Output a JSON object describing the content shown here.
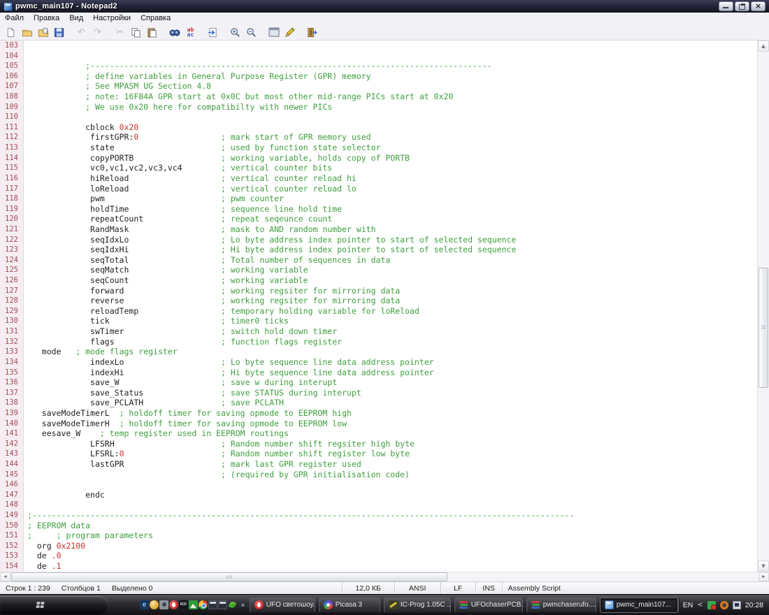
{
  "window": {
    "title": "pwmc_main107 - Notepad2"
  },
  "menu": {
    "items": [
      "Файл",
      "Правка",
      "Вид",
      "Настройки",
      "Справка"
    ]
  },
  "toolbar": {
    "icons": [
      "new-file-icon",
      "open-file-icon",
      "open-folder-view-icon",
      "save-icon",
      "undo-icon",
      "redo-icon",
      "cut-icon",
      "copy-icon",
      "paste-icon",
      "find-icon",
      "replace-icon",
      "goto-icon",
      "zoom-in-icon",
      "zoom-out-icon",
      "console-window-icon",
      "edit-scheme-icon",
      "exit-icon"
    ],
    "undo_glyph": "↶",
    "redo_glyph": "↷",
    "cut_glyph": "✂",
    "replace_top": "ab",
    "replace_bottom": "ac"
  },
  "colors": {
    "comment_green": "#3f9e3f",
    "number_red": "#cc3030",
    "line_number": "#a54e5a",
    "titlebar": "#23253a",
    "taskbar": "#2b2b31"
  },
  "editor": {
    "lines": [
      {
        "n": 103,
        "s": []
      },
      {
        "n": 104,
        "s": []
      },
      {
        "n": 105,
        "s": [
          [
            "c",
            ";-----------------------------------------------------------------------------------",
            12
          ]
        ]
      },
      {
        "n": 106,
        "s": [
          [
            "c",
            "; define variables in General Purpose Register (GPR) memory",
            12
          ]
        ]
      },
      {
        "n": 107,
        "s": [
          [
            "c",
            "; See MPASM UG Section 4.8",
            12
          ]
        ]
      },
      {
        "n": 108,
        "s": [
          [
            "c",
            "; note: 16F84A GPR start at 0x0C but most other mid-range PICs start at 0x20",
            12
          ]
        ]
      },
      {
        "n": 109,
        "s": [
          [
            "c",
            "; We use 0x20 here for compatibilty with newer PICs",
            12
          ]
        ]
      },
      {
        "n": 110,
        "s": []
      },
      {
        "n": 111,
        "s": [
          [
            "p",
            "cblock ",
            12
          ],
          [
            "n",
            "0x20"
          ]
        ]
      },
      {
        "n": 112,
        "s": [
          [
            "p",
            "firstGPR:",
            13
          ],
          [
            "n",
            "0"
          ],
          [
            "c",
            "; mark start of GPR memory used",
            40
          ]
        ]
      },
      {
        "n": 113,
        "s": [
          [
            "p",
            "state",
            13
          ],
          [
            "c",
            "; used by function state selector",
            40
          ]
        ]
      },
      {
        "n": 114,
        "s": [
          [
            "p",
            "copyPORTB",
            13
          ],
          [
            "c",
            "; working variable, holds copy of PORTB",
            40
          ]
        ]
      },
      {
        "n": 115,
        "s": [
          [
            "p",
            "vc0,vc1,vc2,vc3,vc4",
            13
          ],
          [
            "c",
            "; vertical counter bits",
            40
          ]
        ]
      },
      {
        "n": 116,
        "s": [
          [
            "p",
            "hiReload",
            13
          ],
          [
            "c",
            "; vertical counter reload hi",
            40
          ]
        ]
      },
      {
        "n": 117,
        "s": [
          [
            "p",
            "loReload",
            13
          ],
          [
            "c",
            "; vertical counter reload lo",
            40
          ]
        ]
      },
      {
        "n": 118,
        "s": [
          [
            "p",
            "pwm",
            13
          ],
          [
            "c",
            "; pwm counter",
            40
          ]
        ]
      },
      {
        "n": 119,
        "s": [
          [
            "p",
            "holdTime",
            13
          ],
          [
            "c",
            "; sequence line hold time",
            40
          ]
        ]
      },
      {
        "n": 120,
        "s": [
          [
            "p",
            "repeatCount",
            13
          ],
          [
            "c",
            "; repeat seqeunce count",
            40
          ]
        ]
      },
      {
        "n": 121,
        "s": [
          [
            "p",
            "RandMask",
            13
          ],
          [
            "c",
            "; mask to AND random number with",
            40
          ]
        ]
      },
      {
        "n": 122,
        "s": [
          [
            "p",
            "seqIdxLo",
            13
          ],
          [
            "c",
            "; Lo byte address index pointer to start of selected sequence",
            40
          ]
        ]
      },
      {
        "n": 123,
        "s": [
          [
            "p",
            "seqIdxHi",
            13
          ],
          [
            "c",
            "; Hi byte address index pointer to start of selected sequence",
            40
          ]
        ]
      },
      {
        "n": 124,
        "s": [
          [
            "p",
            "seqTotal",
            13
          ],
          [
            "c",
            "; Total number of sequences in data",
            40
          ]
        ]
      },
      {
        "n": 125,
        "s": [
          [
            "p",
            "seqMatch",
            13
          ],
          [
            "c",
            "; working variable",
            40
          ]
        ]
      },
      {
        "n": 126,
        "s": [
          [
            "p",
            "seqCount",
            13
          ],
          [
            "c",
            "; working variable",
            40
          ]
        ]
      },
      {
        "n": 127,
        "s": [
          [
            "p",
            "forward",
            13
          ],
          [
            "c",
            "; working regsiter for mirroring data",
            40
          ]
        ]
      },
      {
        "n": 128,
        "s": [
          [
            "p",
            "reverse",
            13
          ],
          [
            "c",
            "; working regsiter for mirroring data",
            40
          ]
        ]
      },
      {
        "n": 129,
        "s": [
          [
            "p",
            "reloadTemp",
            13
          ],
          [
            "c",
            "; temporary holding variable for loReload",
            40
          ]
        ]
      },
      {
        "n": 130,
        "s": [
          [
            "p",
            "tick",
            13
          ],
          [
            "c",
            "; timer0 ticks",
            40
          ]
        ]
      },
      {
        "n": 131,
        "s": [
          [
            "p",
            "swTimer",
            13
          ],
          [
            "c",
            "; switch hold down timer",
            40
          ]
        ]
      },
      {
        "n": 132,
        "s": [
          [
            "p",
            "flags",
            13
          ],
          [
            "c",
            "; function flags register",
            40
          ]
        ]
      },
      {
        "n": 133,
        "s": [
          [
            "p",
            "mode",
            3
          ],
          [
            "c",
            "; mode flags register",
            10
          ]
        ]
      },
      {
        "n": 134,
        "s": [
          [
            "p",
            "indexLo",
            13
          ],
          [
            "c",
            "; Lo byte sequence line data address pointer",
            40
          ]
        ]
      },
      {
        "n": 135,
        "s": [
          [
            "p",
            "indexHi",
            13
          ],
          [
            "c",
            "; Hi byte sequence line data address pointer",
            40
          ]
        ]
      },
      {
        "n": 136,
        "s": [
          [
            "p",
            "save_W",
            13
          ],
          [
            "c",
            "; save w during interupt",
            40
          ]
        ]
      },
      {
        "n": 137,
        "s": [
          [
            "p",
            "save_Status",
            13
          ],
          [
            "c",
            "; save STATUS during interupt",
            40
          ]
        ]
      },
      {
        "n": 138,
        "s": [
          [
            "p",
            "save_PCLATH",
            13
          ],
          [
            "c",
            "; save PCLATH",
            40
          ]
        ]
      },
      {
        "n": 139,
        "s": [
          [
            "p",
            "saveModeTimerL",
            3
          ],
          [
            "c",
            "; holdoff timer for saving opmode to EEPROM high",
            19
          ]
        ]
      },
      {
        "n": 140,
        "s": [
          [
            "p",
            "saveModeTimerH",
            3
          ],
          [
            "c",
            "; holdoff timer for saving opmode to EEPROM low",
            19
          ]
        ]
      },
      {
        "n": 141,
        "s": [
          [
            "p",
            "eesave_W",
            3
          ],
          [
            "c",
            "; temp register used in EEPROM routings",
            15
          ]
        ]
      },
      {
        "n": 142,
        "s": [
          [
            "p",
            "LFSRH",
            13
          ],
          [
            "c",
            "; Random number shift regsiter high byte",
            40
          ]
        ]
      },
      {
        "n": 143,
        "s": [
          [
            "p",
            "LFSRL:",
            13
          ],
          [
            "n",
            "0"
          ],
          [
            "c",
            "; Random number shift register low byte",
            40
          ]
        ]
      },
      {
        "n": 144,
        "s": [
          [
            "p",
            "lastGPR",
            13
          ],
          [
            "c",
            "; mark last GPR register used",
            40
          ]
        ]
      },
      {
        "n": 145,
        "s": [
          [
            "c",
            "; (required by GPR initialisation code)",
            40
          ]
        ]
      },
      {
        "n": 146,
        "s": []
      },
      {
        "n": 147,
        "s": [
          [
            "p",
            "endc",
            12
          ]
        ]
      },
      {
        "n": 148,
        "s": []
      },
      {
        "n": 149,
        "s": [
          [
            "c",
            ";----------------------------------------------------------------------------------------------------------------",
            0
          ]
        ]
      },
      {
        "n": 150,
        "s": [
          [
            "c",
            "; EEPROM data",
            0
          ]
        ]
      },
      {
        "n": 151,
        "s": [
          [
            "c",
            ";",
            0
          ],
          [
            "c",
            "; program parameters",
            6
          ]
        ]
      },
      {
        "n": 152,
        "s": [
          [
            "p",
            "org ",
            2
          ],
          [
            "n",
            "0x2100"
          ]
        ]
      },
      {
        "n": 153,
        "s": [
          [
            "p",
            "de ",
            2
          ],
          [
            "n",
            ".0"
          ]
        ]
      },
      {
        "n": 154,
        "s": [
          [
            "p",
            "de ",
            2
          ],
          [
            "n",
            ".1"
          ]
        ]
      }
    ]
  },
  "statusbar": {
    "line": "Строк 1 : 239",
    "column": "Столбцов 1",
    "selection": "Выделено 0",
    "size": "12,0 КБ",
    "encoding": "ANSI",
    "eol": "LF",
    "insert_mode": "INS",
    "syntax": "Assembly Script"
  },
  "taskbar": {
    "overflow_chevron": "»",
    "tasks": [
      {
        "label": "UFO светошоу...",
        "icon": "opera-icon"
      },
      {
        "label": "Picasa 3",
        "icon": "picasa-icon"
      },
      {
        "label": "IC-Prog 1.05C ...",
        "icon": "ic-prog-icon"
      },
      {
        "label": "UFOchaserPCB...",
        "icon": "archive-books-icon"
      },
      {
        "label": "pwmchaserufo....",
        "icon": "archive-books-icon"
      },
      {
        "label": "pwmc_main107...",
        "icon": "notepad2-icon",
        "active": true
      }
    ],
    "quicklaunch": [
      "ie-icon",
      "gold-app-icon",
      "camera-icon",
      "opera-icon",
      "ico-editor-icon",
      "image-viewer-icon",
      "chrome-icon",
      "calendar-icon",
      "calendar-icon",
      "swoosh-icon"
    ],
    "tray": {
      "language": "EN",
      "collapse_chevron": "<",
      "icons": [
        "antivirus-icon",
        "orange-ring-icon",
        "network-icon"
      ],
      "time": "20:28"
    }
  }
}
